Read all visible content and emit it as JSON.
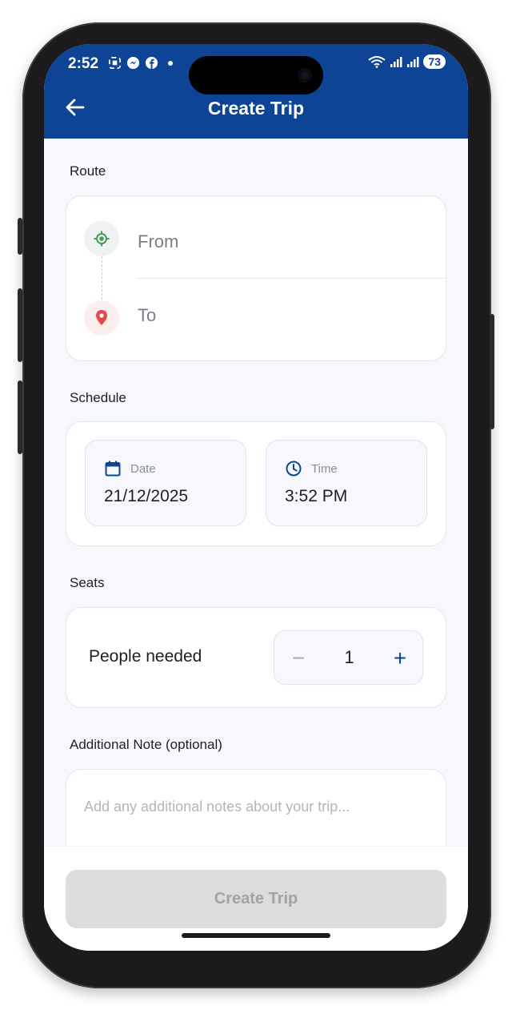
{
  "status_bar": {
    "time": "2:52",
    "battery": "73"
  },
  "header": {
    "title": "Create Trip"
  },
  "route": {
    "label": "Route",
    "from_placeholder": "From",
    "to_placeholder": "To"
  },
  "schedule": {
    "label": "Schedule",
    "date_label": "Date",
    "date_value": "21/12/2025",
    "time_label": "Time",
    "time_value": "3:52 PM"
  },
  "seats": {
    "label": "Seats",
    "people_label": "People needed",
    "count": "1",
    "minus": "−",
    "plus": "+"
  },
  "note": {
    "label": "Additional Note (optional)",
    "placeholder": "Add any additional notes about your trip..."
  },
  "footer": {
    "create_label": "Create Trip"
  },
  "colors": {
    "primary": "#0e4496",
    "from_green": "#4c9a5a",
    "to_red": "#e5484d"
  }
}
